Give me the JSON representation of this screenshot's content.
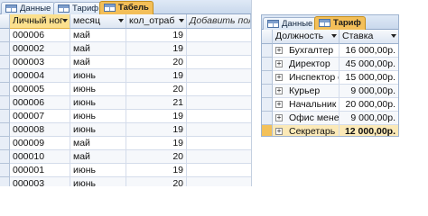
{
  "left_window": {
    "tabs": [
      {
        "label": "Данные",
        "active": false
      },
      {
        "label": "Тариф",
        "active": false
      },
      {
        "label": "Табель",
        "active": true
      }
    ],
    "columns": [
      "Личный ног",
      "месяц",
      "кол_отраб",
      "Добавить поле"
    ],
    "rows": [
      {
        "id": "000006",
        "month": "май",
        "worked": "19"
      },
      {
        "id": "000002",
        "month": "май",
        "worked": "19"
      },
      {
        "id": "000003",
        "month": "май",
        "worked": "20"
      },
      {
        "id": "000004",
        "month": "июнь",
        "worked": "19"
      },
      {
        "id": "000005",
        "month": "июнь",
        "worked": "20"
      },
      {
        "id": "000006",
        "month": "июнь",
        "worked": "21"
      },
      {
        "id": "000007",
        "month": "июнь",
        "worked": "19"
      },
      {
        "id": "000008",
        "month": "июнь",
        "worked": "19"
      },
      {
        "id": "000009",
        "month": "май",
        "worked": "19"
      },
      {
        "id": "000010",
        "month": "май",
        "worked": "20"
      },
      {
        "id": "000001",
        "month": "июнь",
        "worked": "19"
      },
      {
        "id": "000003",
        "month": "июнь",
        "worked": "20"
      }
    ]
  },
  "right_window": {
    "tabs": [
      {
        "label": "Данные",
        "active": false
      },
      {
        "label": "Тариф",
        "active": true
      }
    ],
    "columns": [
      "Должность",
      "Ставка"
    ],
    "rows": [
      {
        "position": "Бухгалтер",
        "rate": "16 000,00р."
      },
      {
        "position": "Директор",
        "rate": "45 000,00р."
      },
      {
        "position": "Инспектор отд",
        "rate": "15 000,00р."
      },
      {
        "position": "Курьер",
        "rate": "9 000,00р."
      },
      {
        "position": "Начальник отд",
        "rate": "20 000,00р."
      },
      {
        "position": "Офис менедж",
        "rate": "9 000,00р."
      },
      {
        "position": "Секретарь",
        "rate": "12 000,00р."
      }
    ],
    "expand_symbol": "+",
    "new_row_symbol": "✱"
  },
  "colors": {
    "active_tab": "#f3bf59",
    "header_highlight": "#fbe08e",
    "current_row": "#fbe9b7",
    "grid_line": "#d4dceb"
  }
}
